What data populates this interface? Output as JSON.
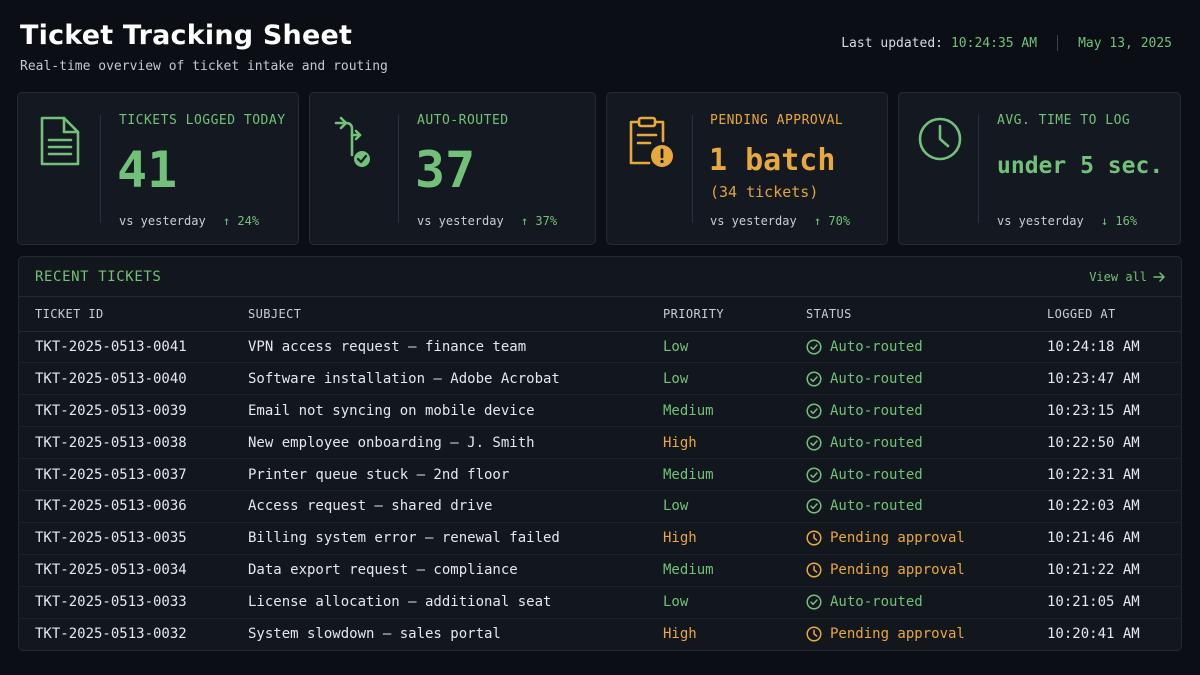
{
  "header": {
    "title": "Ticket Tracking Sheet",
    "subtitle": "Real-time overview of ticket intake and routing",
    "last_updated_label": "Last updated:",
    "last_updated_time": "10:24:35 AM",
    "date": "May 13, 2025"
  },
  "cards": [
    {
      "icon": "document-icon",
      "label": "TICKETS LOGGED TODAY",
      "value": "41",
      "sub": "",
      "foot_label": "vs yesterday",
      "delta": "↑ 24%"
    },
    {
      "icon": "route-check-icon",
      "label": "AUTO-ROUTED",
      "value": "37",
      "sub": "",
      "foot_label": "vs yesterday",
      "delta": "↑ 37%"
    },
    {
      "icon": "clipboard-alert-icon",
      "label": "PENDING APPROVAL",
      "value": "1 batch",
      "sub": "(34 tickets)",
      "foot_label": "vs yesterday",
      "delta": "↑ 70%"
    },
    {
      "icon": "clock-icon",
      "label": "AVG. TIME TO LOG",
      "value": "under 5 sec.",
      "sub": "",
      "foot_label": "vs yesterday",
      "delta": "↓ 16%"
    }
  ],
  "recent": {
    "title": "RECENT TICKETS",
    "view_all": "View all",
    "columns": [
      "TICKET ID",
      "SUBJECT",
      "PRIORITY",
      "STATUS",
      "LOGGED AT"
    ],
    "rows": [
      {
        "id": "TKT-2025-0513-0041",
        "subject": "VPN access request – finance team",
        "priority": "Low",
        "status": "Auto-routed",
        "logged": "10:24:18 AM"
      },
      {
        "id": "TKT-2025-0513-0040",
        "subject": "Software installation – Adobe Acrobat",
        "priority": "Low",
        "status": "Auto-routed",
        "logged": "10:23:47 AM"
      },
      {
        "id": "TKT-2025-0513-0039",
        "subject": "Email not syncing on mobile device",
        "priority": "Medium",
        "status": "Auto-routed",
        "logged": "10:23:15 AM"
      },
      {
        "id": "TKT-2025-0513-0038",
        "subject": "New employee onboarding – J. Smith",
        "priority": "High",
        "status": "Auto-routed",
        "logged": "10:22:50 AM"
      },
      {
        "id": "TKT-2025-0513-0037",
        "subject": "Printer queue stuck – 2nd floor",
        "priority": "Medium",
        "status": "Auto-routed",
        "logged": "10:22:31 AM"
      },
      {
        "id": "TKT-2025-0513-0036",
        "subject": "Access request – shared drive",
        "priority": "Low",
        "status": "Auto-routed",
        "logged": "10:22:03 AM"
      },
      {
        "id": "TKT-2025-0513-0035",
        "subject": "Billing system error – renewal failed",
        "priority": "High",
        "status": "Pending approval",
        "logged": "10:21:46 AM"
      },
      {
        "id": "TKT-2025-0513-0034",
        "subject": "Data export request – compliance",
        "priority": "Medium",
        "status": "Pending approval",
        "logged": "10:21:22 AM"
      },
      {
        "id": "TKT-2025-0513-0033",
        "subject": "License allocation – additional seat",
        "priority": "Low",
        "status": "Auto-routed",
        "logged": "10:21:05 AM"
      },
      {
        "id": "TKT-2025-0513-0032",
        "subject": "System slowdown – sales portal",
        "priority": "High",
        "status": "Pending approval",
        "logged": "10:20:41 AM"
      }
    ]
  },
  "colors": {
    "green": "#72c17a",
    "amber": "#e7a83c",
    "background": "#0b0e14",
    "card": "#141820"
  }
}
